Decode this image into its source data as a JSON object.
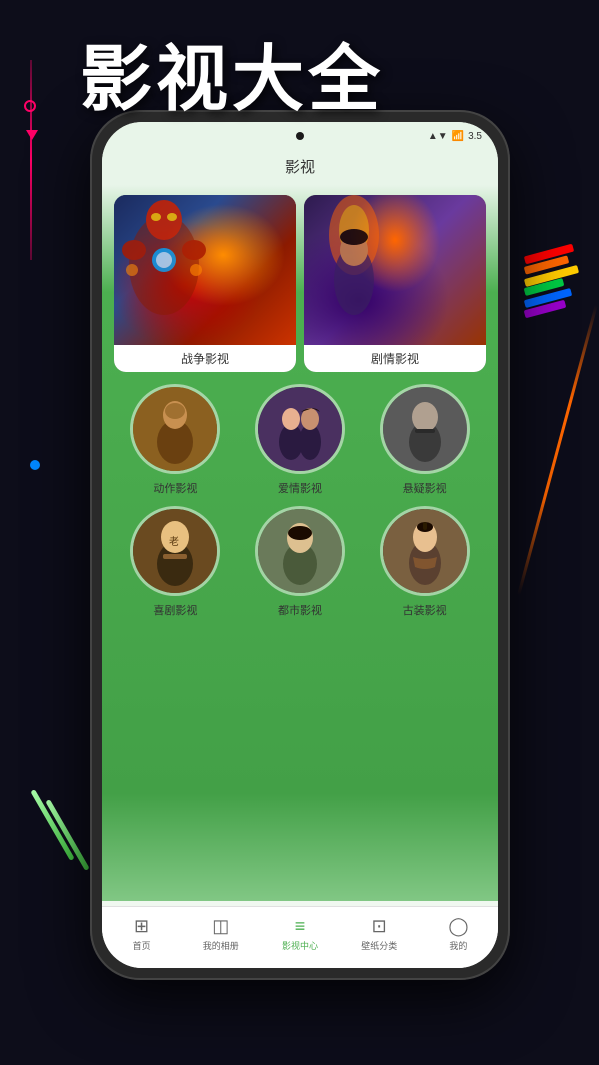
{
  "page": {
    "title": "影视大全",
    "background_color": "#0d0d1a"
  },
  "phone": {
    "status_bar": {
      "time": "",
      "signal": "▲▼",
      "wifi": "WiFi",
      "battery": "3.5"
    },
    "app_title": "影视",
    "featured_cards": [
      {
        "id": "war",
        "label": "战争影视",
        "theme": "ironman"
      },
      {
        "id": "drama",
        "label": "剧情影视",
        "theme": "aladdin"
      }
    ],
    "categories": [
      {
        "id": "action",
        "label": "动作影视",
        "theme": "action"
      },
      {
        "id": "romance",
        "label": "爱情影视",
        "theme": "romance"
      },
      {
        "id": "suspense",
        "label": "悬疑影视",
        "theme": "suspense"
      },
      {
        "id": "comedy",
        "label": "喜剧影视",
        "theme": "comedy"
      },
      {
        "id": "city",
        "label": "都市影视",
        "theme": "city"
      },
      {
        "id": "ancient",
        "label": "古装影视",
        "theme": "ancient"
      }
    ],
    "nav_items": [
      {
        "id": "home",
        "label": "首页",
        "icon": "⊞",
        "active": false
      },
      {
        "id": "album",
        "label": "我的相册",
        "icon": "◫",
        "active": false
      },
      {
        "id": "video_center",
        "label": "影视中心",
        "icon": "≡",
        "active": true
      },
      {
        "id": "wallpaper",
        "label": "壁纸分类",
        "icon": "⊡",
        "active": false
      },
      {
        "id": "mine",
        "label": "我的",
        "icon": "◯",
        "active": false
      }
    ]
  },
  "decorations": {
    "stripe_colors": [
      "#ff0000",
      "#ff6600",
      "#ffcc00",
      "#00cc00",
      "#0066ff",
      "#9900cc"
    ]
  }
}
